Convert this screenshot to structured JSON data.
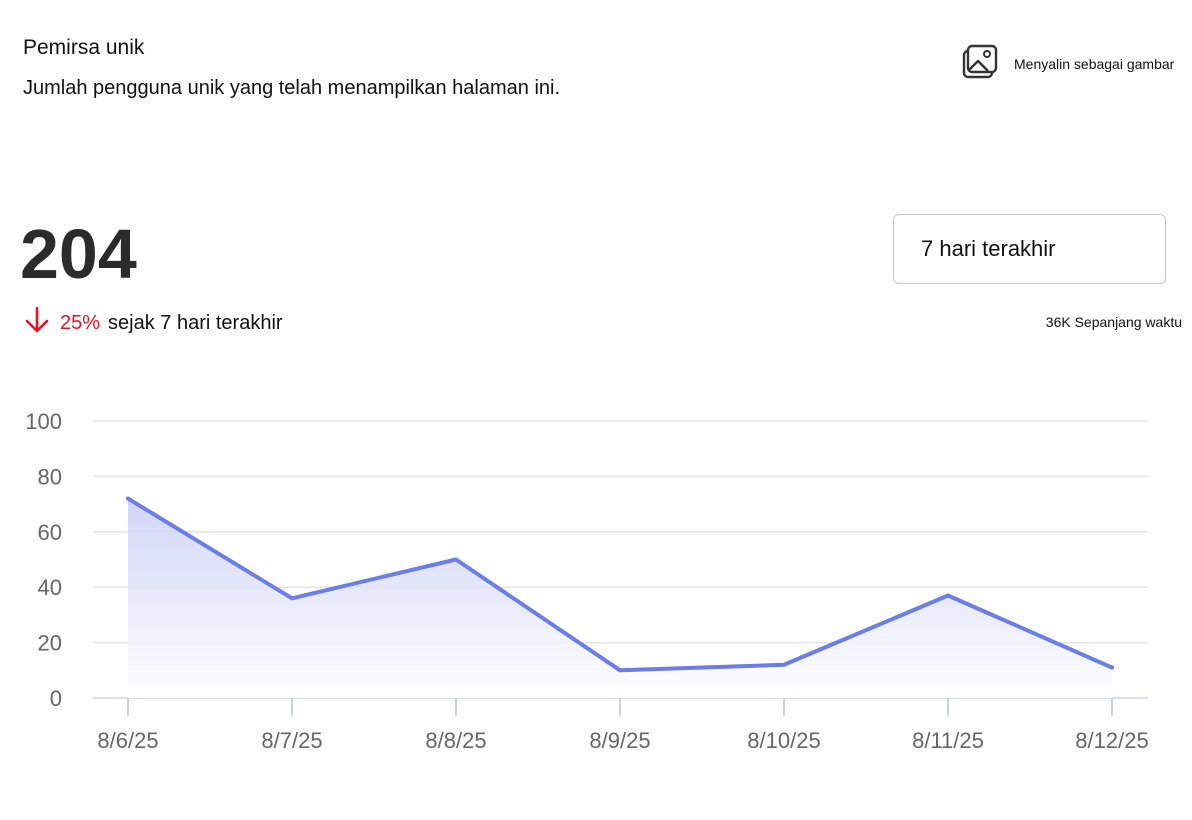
{
  "header": {
    "title": "Pemirsa unik",
    "subtitle": "Jumlah pengguna unik yang telah menampilkan halaman ini.",
    "copy_label": "Menyalin sebagai gambar",
    "copy_icon": "image-icon"
  },
  "summary": {
    "value": "204",
    "trend_icon": "arrow-down-icon",
    "trend_percent": "25%",
    "trend_text": "sejak 7 hari terakhir",
    "range_value": "7 hari terakhir",
    "all_time": "36K Sepanjang waktu"
  },
  "colors": {
    "accent": "#6a7de8",
    "decrease": "#e81123"
  },
  "chart_data": {
    "type": "area",
    "categories": [
      "8/6/25",
      "8/7/25",
      "8/8/25",
      "8/9/25",
      "8/10/25",
      "8/11/25",
      "8/12/25"
    ],
    "values": [
      72,
      36,
      50,
      10,
      12,
      37,
      11
    ],
    "ylim": [
      0,
      100
    ],
    "yticks": [
      0,
      20,
      40,
      60,
      80,
      100
    ],
    "grid": true
  }
}
